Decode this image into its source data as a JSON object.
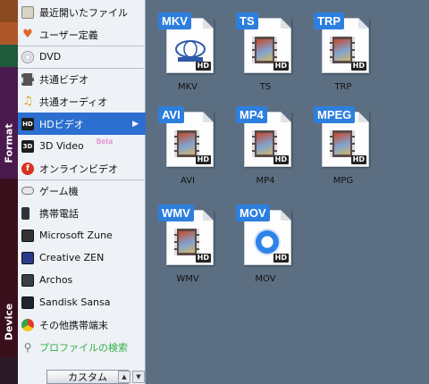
{
  "sidebar": {
    "format_label": "Format",
    "device_label": "Device",
    "items": [
      {
        "label": "最近開いたファイル",
        "icon": "recent-files-icon"
      },
      {
        "label": "ユーザー定義",
        "icon": "heart-icon"
      },
      {
        "label": "DVD",
        "icon": "disc-icon"
      },
      {
        "label": "共通ビデオ",
        "icon": "video-icon"
      },
      {
        "label": "共通オーディオ",
        "icon": "music-note-icon"
      },
      {
        "label": "HDビデオ",
        "icon": "hd-icon",
        "selected": true
      },
      {
        "label": "3D Video",
        "icon": "3d-icon",
        "badge": "Beta"
      },
      {
        "label": "オンラインビデオ",
        "icon": "flash-icon"
      },
      {
        "label": "ゲーム機",
        "icon": "gamepad-icon"
      },
      {
        "label": "携帯電話",
        "icon": "mobile-phone-icon"
      },
      {
        "label": "Microsoft Zune",
        "icon": "zune-icon"
      },
      {
        "label": "Creative ZEN",
        "icon": "zen-icon"
      },
      {
        "label": "Archos",
        "icon": "archos-icon"
      },
      {
        "label": "Sandisk Sansa",
        "icon": "sansa-icon"
      },
      {
        "label": "その他携帯端末",
        "icon": "chrome-icon"
      },
      {
        "label": "プロファイルの検索",
        "icon": "search-icon"
      }
    ],
    "custom_button": "カスタム",
    "hd_icon_text": "HD",
    "three_d_icon_text": "3D",
    "flash_icon_text": "f"
  },
  "formats": [
    {
      "tag": "MKV",
      "label": "MKV"
    },
    {
      "tag": "TS",
      "label": "TS"
    },
    {
      "tag": "TRP",
      "label": "TRP"
    },
    {
      "tag": "AVI",
      "label": "AVI"
    },
    {
      "tag": "MP4",
      "label": "MP4"
    },
    {
      "tag": "MPEG",
      "label": "MPG"
    },
    {
      "tag": "WMV",
      "label": "WMV"
    },
    {
      "tag": "MOV",
      "label": "MOV"
    }
  ],
  "hd_badge": "HD",
  "colors": {
    "accent": "#2c6fd0",
    "tag_blue": "#2d7fde",
    "panel_bg": "#5c6f82",
    "menu_bg": "#eef1f6",
    "format_strip": "#4a1a4e",
    "device_strip": "#3a0f1c",
    "search_text": "#33b04a"
  }
}
